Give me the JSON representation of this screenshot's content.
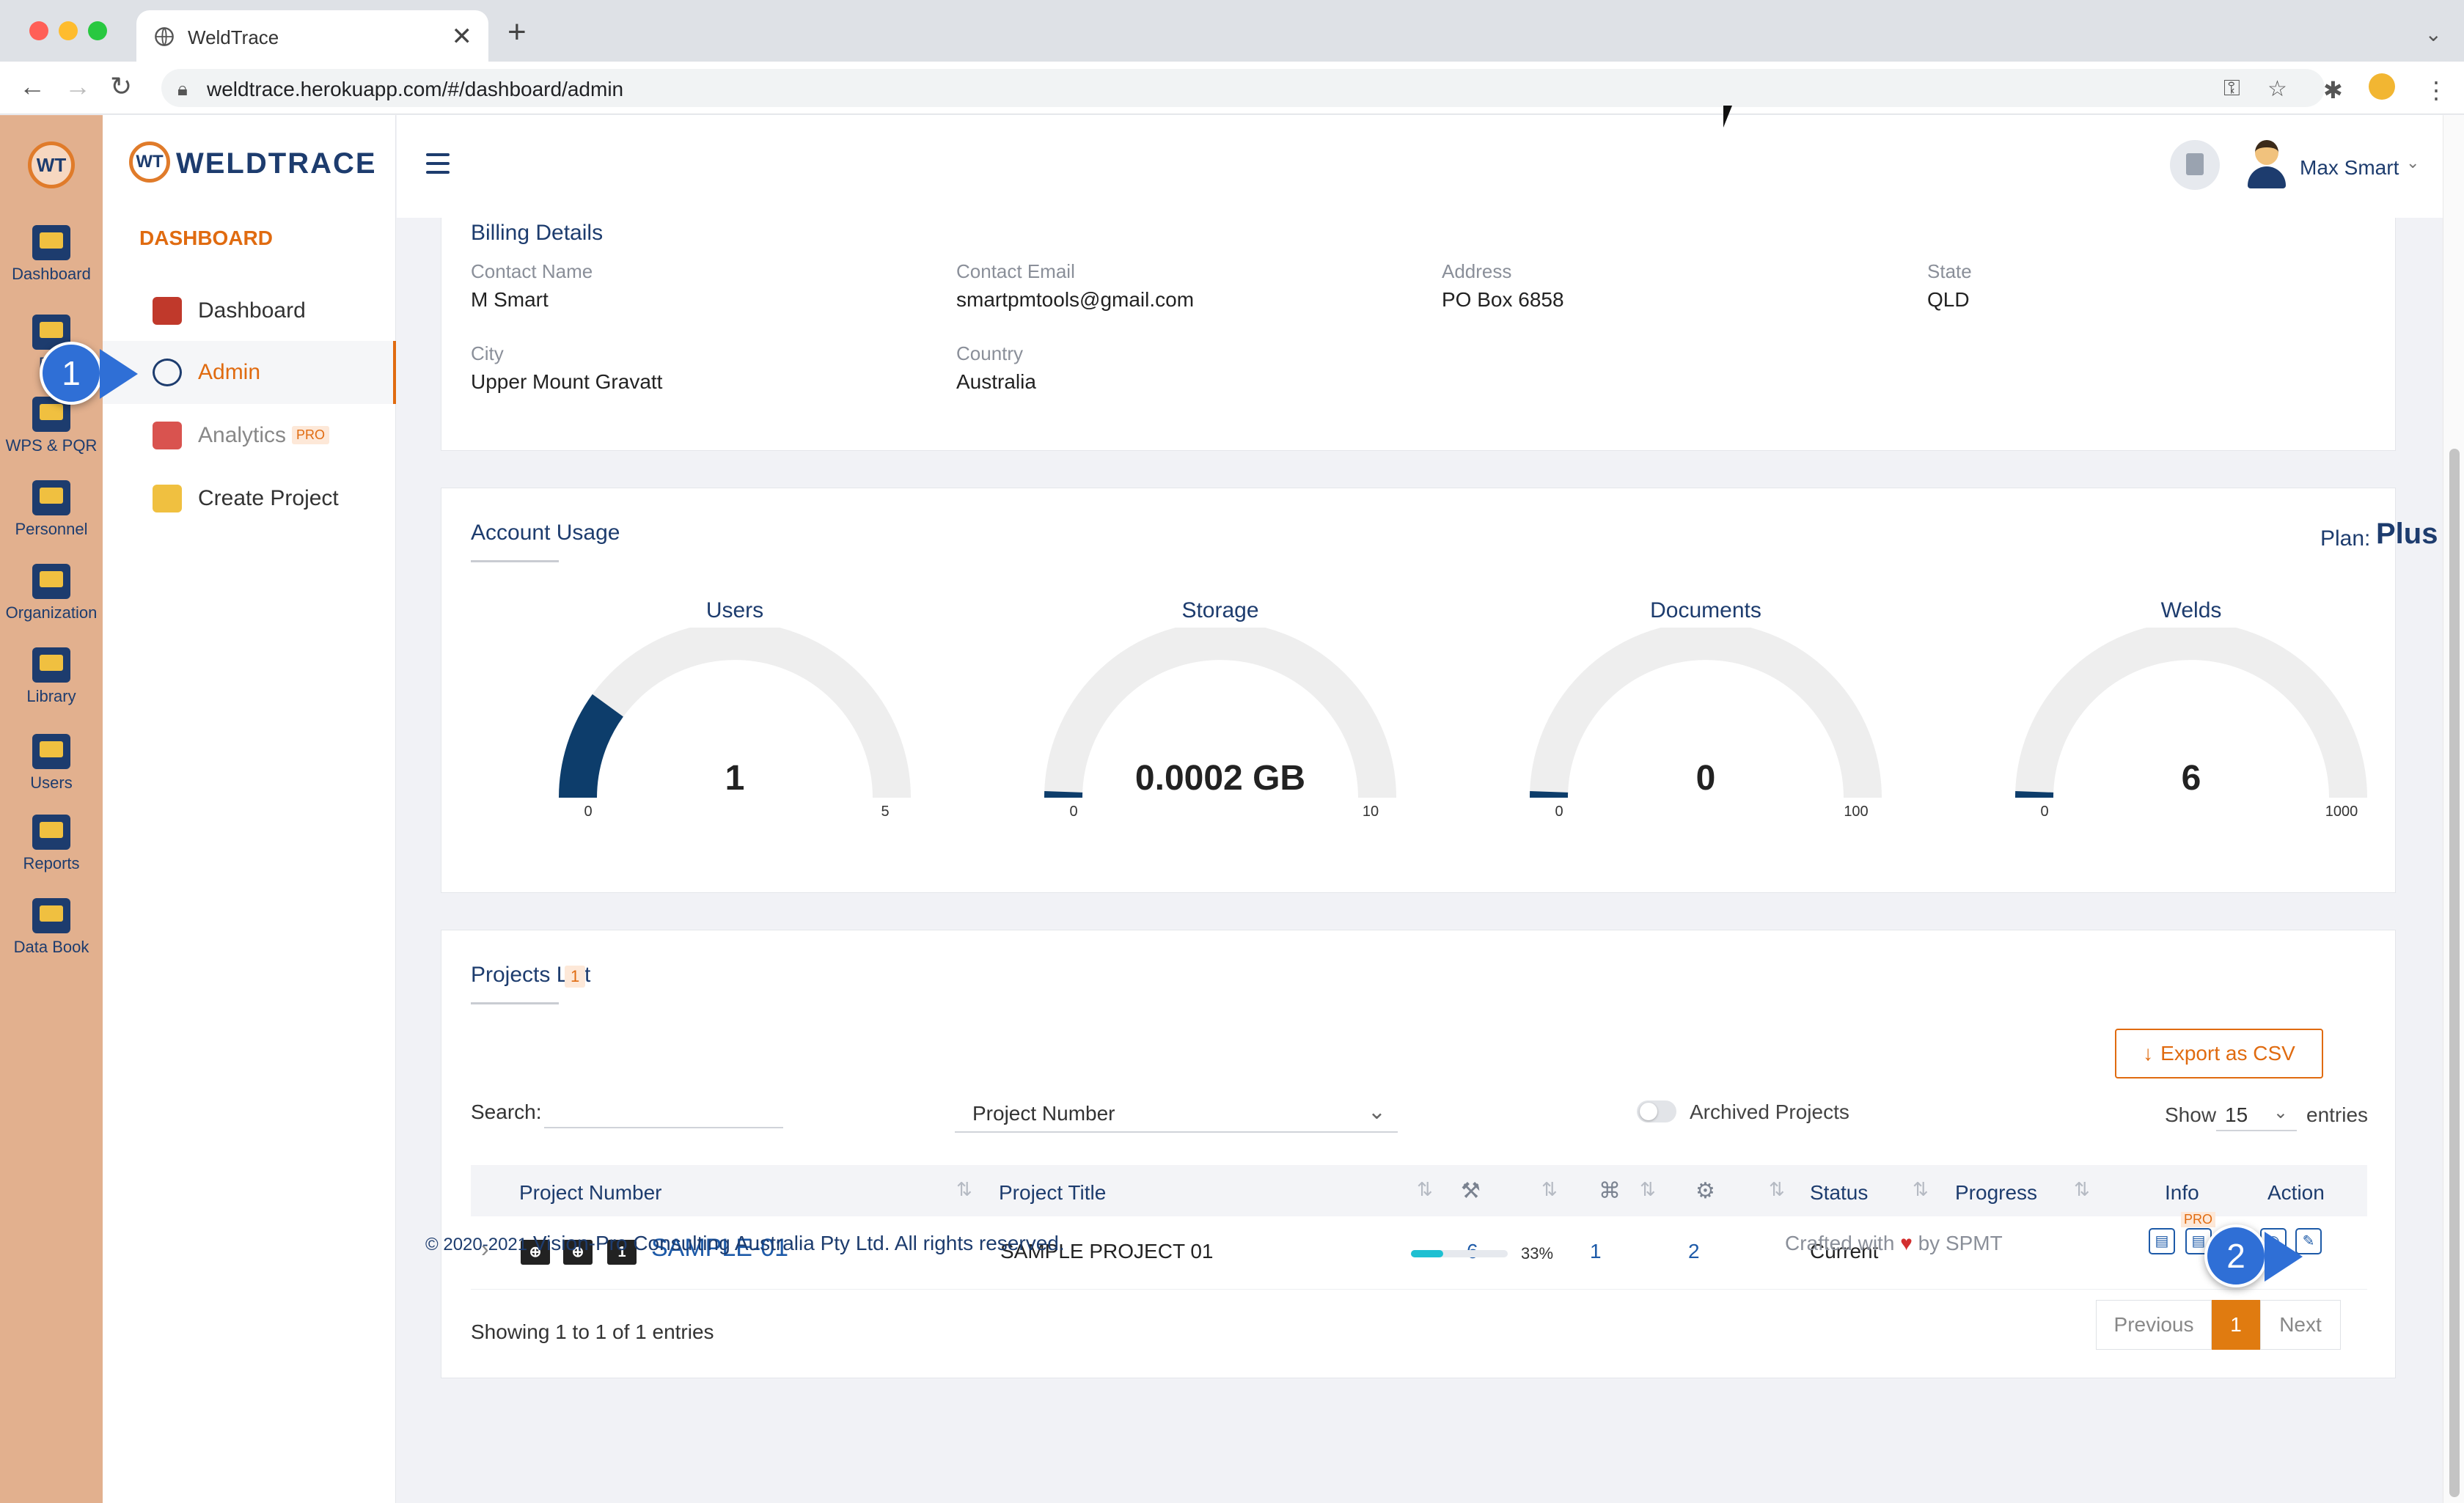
{
  "browser": {
    "tab_title": "WeldTrace",
    "url": "weldtrace.herokuapp.com/#/dashboard/admin",
    "new_tab": "+",
    "close_tab": "✕"
  },
  "rail": {
    "logo": "WT",
    "items": [
      {
        "label": "Dashboard"
      },
      {
        "label": "Pro"
      },
      {
        "label": "WPS & PQR"
      },
      {
        "label": "Personnel"
      },
      {
        "label": "Organization"
      },
      {
        "label": "Library"
      },
      {
        "label": "Users"
      },
      {
        "label": "Reports"
      },
      {
        "label": "Data Book"
      }
    ]
  },
  "sidebar": {
    "brand": "WELDTRACE",
    "brand_mark": "WT",
    "section": "DASHBOARD",
    "items": [
      {
        "label": "Dashboard"
      },
      {
        "label": "Admin"
      },
      {
        "label": "Analytics",
        "badge": "PRO"
      },
      {
        "label": "Create Project"
      }
    ]
  },
  "header": {
    "user_name": "Max Smart"
  },
  "billing": {
    "title": "Billing Details",
    "contact_name_label": "Contact Name",
    "contact_name": "M Smart",
    "contact_email_label": "Contact Email",
    "contact_email": "smartpmtools@gmail.com",
    "address_label": "Address",
    "address": "PO Box 6858",
    "state_label": "State",
    "state": "QLD",
    "city_label": "City",
    "city": "Upper Mount Gravatt",
    "country_label": "Country",
    "country": "Australia"
  },
  "usage": {
    "title": "Account Usage",
    "plan_label": "Plan:",
    "plan": "Plus",
    "gauges": [
      {
        "title": "Users",
        "value": "1",
        "numeric": 1,
        "min": "0",
        "max": "5",
        "max_num": 5
      },
      {
        "title": "Storage",
        "value": "0.0002 GB",
        "numeric": 0.0002,
        "min": "0",
        "max": "10",
        "max_num": 10
      },
      {
        "title": "Documents",
        "value": "0",
        "numeric": 0,
        "min": "0",
        "max": "100",
        "max_num": 100
      },
      {
        "title": "Welds",
        "value": "6",
        "numeric": 6,
        "min": "0",
        "max": "1000",
        "max_num": 1000
      }
    ],
    "colors": {
      "fill": "#0d3d6b",
      "track": "#eeeeee"
    }
  },
  "projects": {
    "title": "Projects List",
    "count_badge": "1",
    "export_label": "Export as CSV",
    "search_label": "Search:",
    "search_value": "",
    "filter_value": "Project Number",
    "archived_label": "Archived Projects",
    "show_label": "Show",
    "show_value": "15",
    "entries_label": "entries",
    "columns": {
      "project_number": "Project Number",
      "project_title": "Project Title",
      "status": "Status",
      "progress": "Progress",
      "info": "Info",
      "action": "Action"
    },
    "rows": [
      {
        "badges": [
          "⊕",
          "⊕",
          "1"
        ],
        "number": "SAMPLE-01",
        "title": "SAMPLE PROJECT 01",
        "count1": "6",
        "count2": "1",
        "count3": "2",
        "status": "Current",
        "progress": 0.33,
        "progress_text": "33%",
        "pro_badge": "PRO"
      }
    ],
    "showing": "Showing 1 to 1 of 1 entries",
    "pager": {
      "previous": "Previous",
      "current": "1",
      "next": "Next"
    }
  },
  "footer": {
    "copyright_symbol": "© 2020-2021",
    "company": "Vision-Pro Consulting Australia Pty Ltd. All rights reserved.",
    "crafted": "Crafted with",
    "heart": "♥",
    "by": "by SPMT"
  },
  "callouts": {
    "one": "1",
    "two": "2"
  }
}
